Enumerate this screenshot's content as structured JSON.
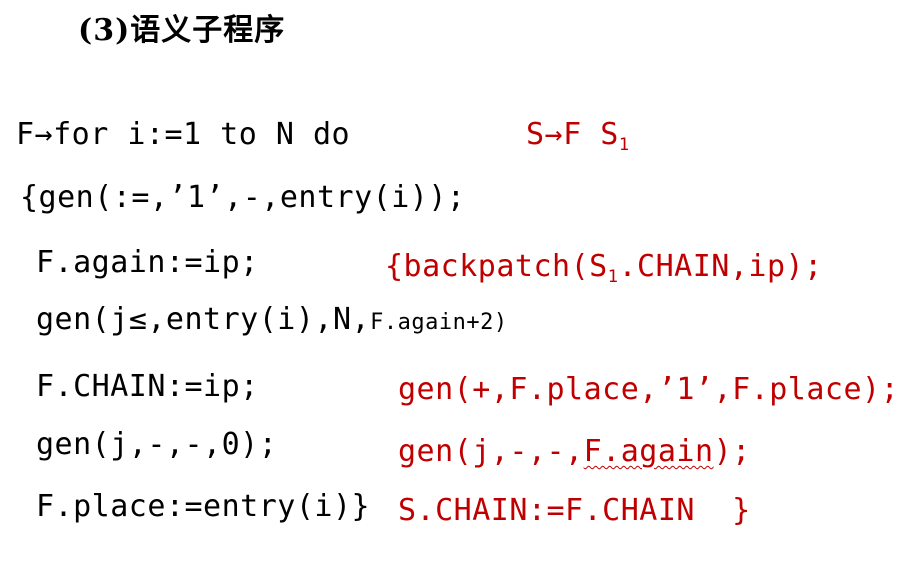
{
  "title": "(3)语义子程序",
  "left": {
    "line1": "F→for i:=1 to N do",
    "line2": "{gen(:=,’1’,-,entry(i));",
    "line3": "F.again:=ip;",
    "line4_main": "gen(j≤,entry(i),N,",
    "line4_small": "F.again+2)",
    "line5": "F.CHAIN:=ip;",
    "line6": "gen(j,-,-,0);",
    "line7": "F.place:=entry(i)}"
  },
  "right": {
    "prod_main": "S→F S",
    "prod_sub": "1",
    "rline1_a": "{backpatch(S",
    "rline1_sub": "1",
    "rline1_b": ".CHAIN,ip);",
    "rline2": "gen(+,F.place,’1’,F.place);",
    "rline3_a": "gen(j,-,-,",
    "rline3_underlined": "F.again",
    "rline3_b": ");",
    "rline4": "S.CHAIN:=F.CHAIN  }"
  },
  "colors": {
    "text": "#000000",
    "accent": "#c00000"
  }
}
